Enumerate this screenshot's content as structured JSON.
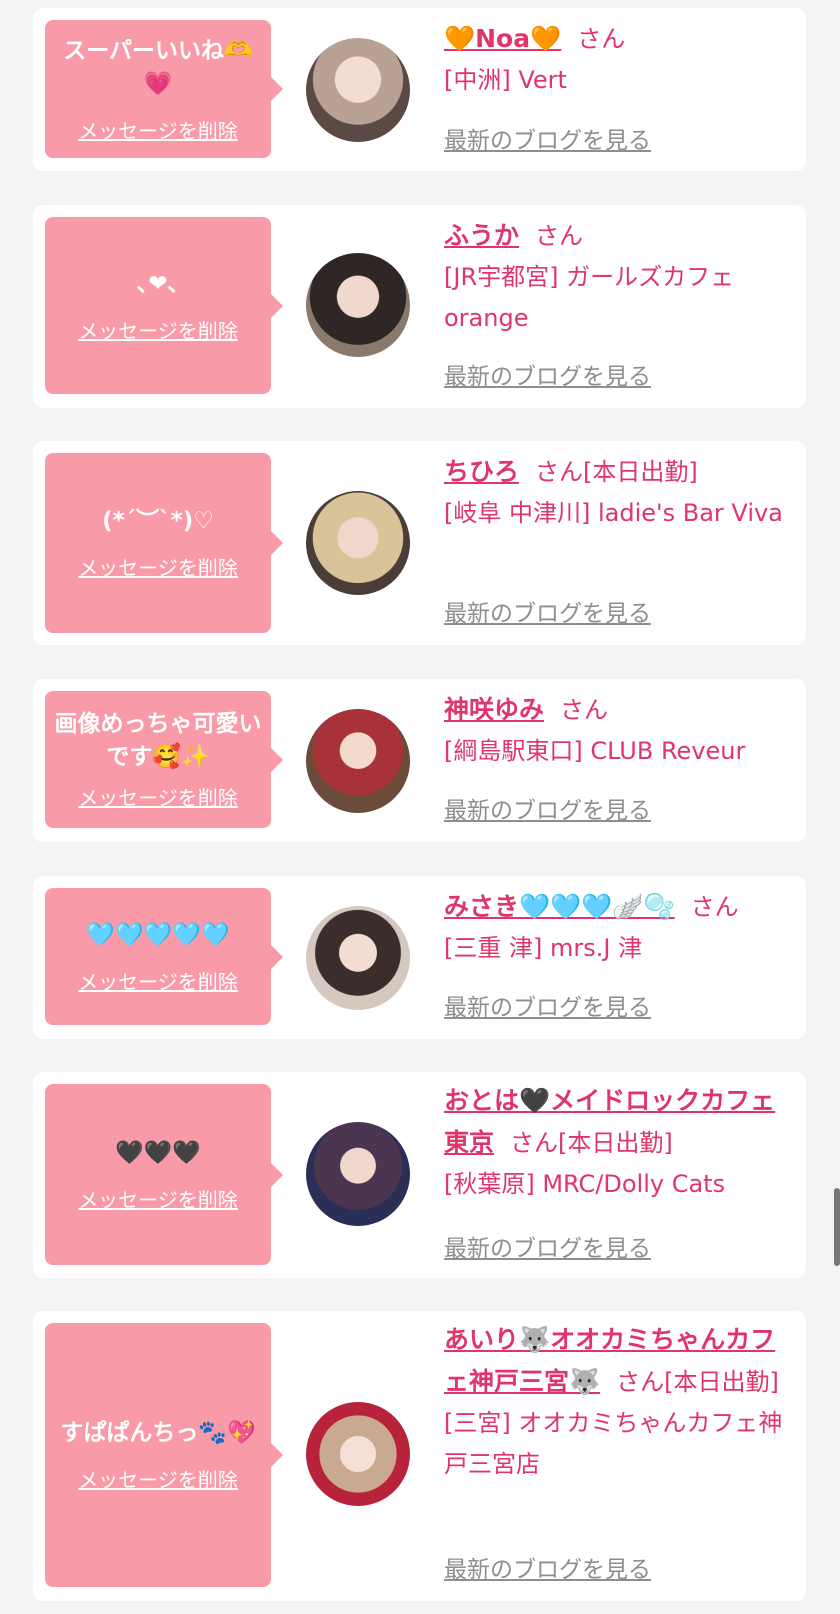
{
  "delete_label": "メッセージを削除",
  "blog_label": "最新のブログを見る",
  "san_label": "さん",
  "colors": {
    "accent": "#e0356a",
    "bubble": "#f99aa9",
    "link_gray": "#8e8e8e"
  },
  "entries": [
    {
      "message": "スーパーいいね🫶💗",
      "name": "🧡Noa🧡",
      "status": "",
      "shop": "[中洲] Vert"
    },
    {
      "message": "､❤︎､",
      "name": "ふうか",
      "status": "",
      "shop": "[JR宇都宮] ガールズカフェorange"
    },
    {
      "message": "(*´︶`*)♡",
      "name": "ちひろ",
      "status": "[本日出勤]",
      "shop": "[岐阜 中津川] ladie's Bar Viva"
    },
    {
      "message": "画像めっちゃ可愛いです🥰✨",
      "name": "神咲ゆみ",
      "status": "",
      "shop": "[綱島駅東口] CLUB Reveur"
    },
    {
      "message": "🩵🩵🩵🩵🩵",
      "name": "みさき🩵🩵🩵🪽🫧",
      "status": "",
      "shop": "[三重 津] mrs.J 津"
    },
    {
      "message": "🖤🖤🖤",
      "name": "おとは🖤メイドロックカフェ東京",
      "status": "[本日出勤]",
      "shop": "[秋葉原] MRC/Dolly Cats"
    },
    {
      "message": "すぱぱんちっ🐾💖",
      "name": "あいり🐺オオカミちゃんカフェ神戸三宮🐺",
      "status": "[本日出勤]",
      "shop": "[三宮] オオカミちゃんカフェ神戸三宮店"
    }
  ]
}
